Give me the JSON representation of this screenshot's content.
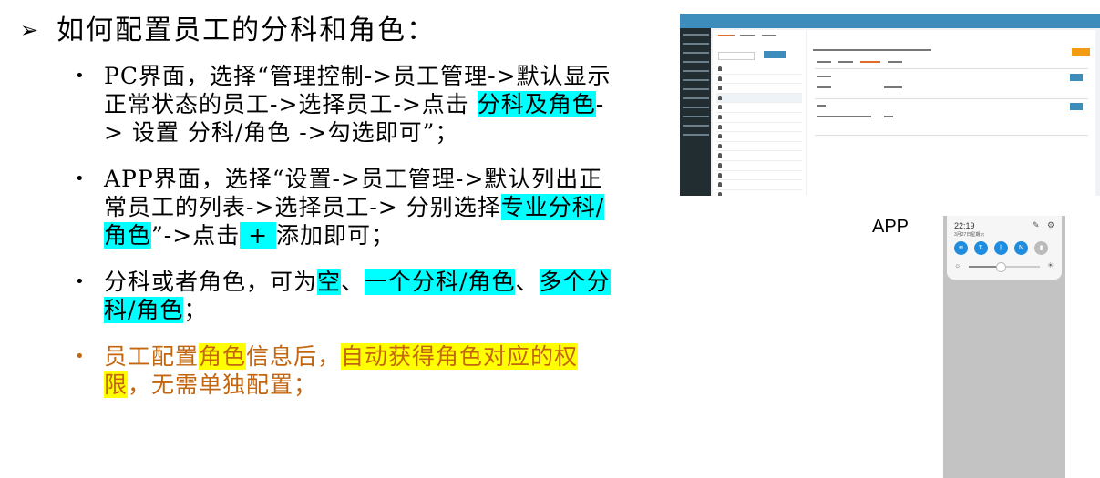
{
  "title": "如何配置员工的分科和角色：",
  "bullets": [
    {
      "pre": "PC界面，选择“管理控制->员工管理->默认显示正常状态的员工->选择员工->点击 ",
      "hl1": "分科及角色",
      "post": "-> 设置 分科/角色 ->勾选即可”；"
    },
    {
      "pre": "APP界面，选择“设置->员工管理->默认列出正常员工的列表->选择员工-> 分别选择",
      "hl1": "专业分科/角色",
      "mid": "”->点击",
      "hl2": " + ",
      "post": "添加即可；"
    },
    {
      "pre": "分科或者角色，可为",
      "hl1": "空",
      "mid1": "、",
      "hl2": "一个分科/角色",
      "mid2": "、",
      "hl3": "多个分科/角色",
      "post": "；"
    },
    {
      "hl1": "员工配置",
      "hl2": "角色",
      "mid": "信息后，",
      "hl3": "自动获得角色对应的权限",
      "post": "，无需单独配置；"
    }
  ],
  "app_label": "APP",
  "phone": {
    "time": "22:19",
    "date": "3月27日星期六"
  },
  "colors": {
    "highlight_cyan": "#00ffff",
    "highlight_yellow": "#ffff00",
    "orange_text": "#c4650f"
  }
}
